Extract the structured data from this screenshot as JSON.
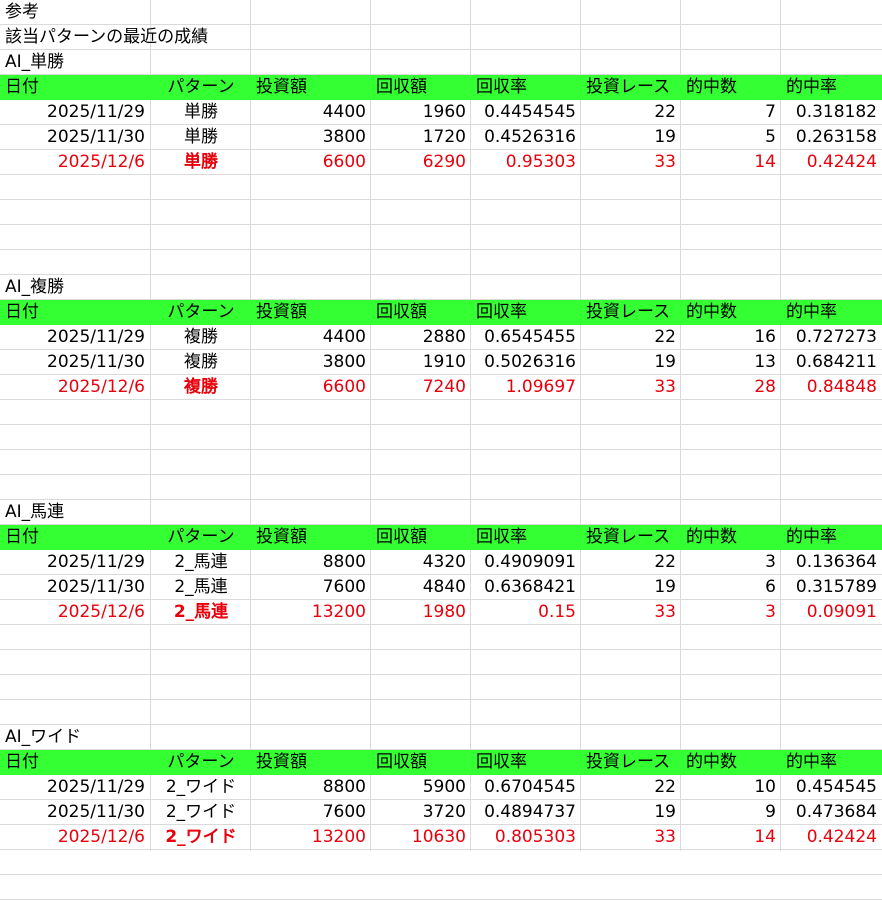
{
  "title": "参考",
  "subtitle": "該当パターンの最近の成績",
  "headers": [
    "日付",
    "パターン",
    "投資額",
    "回収額",
    "回収率",
    "投資レース",
    "的中数",
    "的中率"
  ],
  "colors": {
    "header_fill": "#33ff33",
    "latest_text": "#e8000b",
    "gridline": "#dadada"
  },
  "sections": [
    {
      "name": "AI_単勝",
      "rows": [
        {
          "date": "2025/11/29",
          "pattern": "単勝",
          "invest": "4400",
          "return": "1960",
          "return_rate": "0.4454545",
          "races": "22",
          "hits": "7",
          "hit_rate": "0.318182",
          "latest": false
        },
        {
          "date": "2025/11/30",
          "pattern": "単勝",
          "invest": "3800",
          "return": "1720",
          "return_rate": "0.4526316",
          "races": "19",
          "hits": "5",
          "hit_rate": "0.263158",
          "latest": false
        },
        {
          "date": "2025/12/6",
          "pattern": "単勝",
          "invest": "6600",
          "return": "6290",
          "return_rate": "0.95303",
          "races": "33",
          "hits": "14",
          "hit_rate": "0.42424",
          "latest": true
        }
      ]
    },
    {
      "name": "AI_複勝",
      "rows": [
        {
          "date": "2025/11/29",
          "pattern": "複勝",
          "invest": "4400",
          "return": "2880",
          "return_rate": "0.6545455",
          "races": "22",
          "hits": "16",
          "hit_rate": "0.727273",
          "latest": false
        },
        {
          "date": "2025/11/30",
          "pattern": "複勝",
          "invest": "3800",
          "return": "1910",
          "return_rate": "0.5026316",
          "races": "19",
          "hits": "13",
          "hit_rate": "0.684211",
          "latest": false
        },
        {
          "date": "2025/12/6",
          "pattern": "複勝",
          "invest": "6600",
          "return": "7240",
          "return_rate": "1.09697",
          "races": "33",
          "hits": "28",
          "hit_rate": "0.84848",
          "latest": true
        }
      ]
    },
    {
      "name": "AI_馬連",
      "rows": [
        {
          "date": "2025/11/29",
          "pattern": "2_馬連",
          "invest": "8800",
          "return": "4320",
          "return_rate": "0.4909091",
          "races": "22",
          "hits": "3",
          "hit_rate": "0.136364",
          "latest": false
        },
        {
          "date": "2025/11/30",
          "pattern": "2_馬連",
          "invest": "7600",
          "return": "4840",
          "return_rate": "0.6368421",
          "races": "19",
          "hits": "6",
          "hit_rate": "0.315789",
          "latest": false
        },
        {
          "date": "2025/12/6",
          "pattern": "2_馬連",
          "invest": "13200",
          "return": "1980",
          "return_rate": "0.15",
          "races": "33",
          "hits": "3",
          "hit_rate": "0.09091",
          "latest": true
        }
      ]
    },
    {
      "name": "AI_ワイド",
      "rows": [
        {
          "date": "2025/11/29",
          "pattern": "2_ワイド",
          "invest": "8800",
          "return": "5900",
          "return_rate": "0.6704545",
          "races": "22",
          "hits": "10",
          "hit_rate": "0.454545",
          "latest": false
        },
        {
          "date": "2025/11/30",
          "pattern": "2_ワイド",
          "invest": "7600",
          "return": "3720",
          "return_rate": "0.4894737",
          "races": "19",
          "hits": "9",
          "hit_rate": "0.473684",
          "latest": false
        },
        {
          "date": "2025/12/6",
          "pattern": "2_ワイド",
          "invest": "13200",
          "return": "10630",
          "return_rate": "0.805303",
          "races": "33",
          "hits": "14",
          "hit_rate": "0.42424",
          "latest": true
        }
      ]
    }
  ]
}
